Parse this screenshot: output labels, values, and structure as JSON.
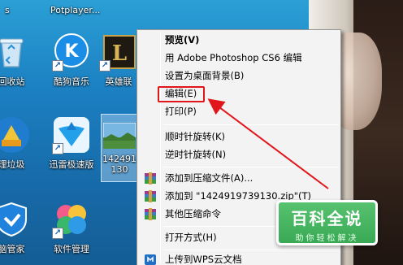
{
  "desktop": {
    "top_labels": [
      "s",
      "Potplayer..."
    ],
    "icons": [
      {
        "label": "回收站",
        "icon": "recycle-bin-icon"
      },
      {
        "label": "酷狗音乐",
        "icon": "kugou-music-icon"
      },
      {
        "label": "英雄联",
        "icon": "league-of-legends-icon"
      },
      {
        "label": "理垃圾",
        "icon": "cleanup-icon"
      },
      {
        "label": "迅雷极速版",
        "icon": "xunlei-icon"
      },
      {
        "label": "142491",
        "label2": "130",
        "icon": "image-file-icon"
      },
      {
        "label": "脑管家",
        "icon": "pc-manager-icon"
      },
      {
        "label": "软件管理",
        "icon": "software-manager-icon"
      }
    ]
  },
  "context_menu": {
    "items": [
      {
        "label": "预览(V)",
        "bold": true
      },
      {
        "label": "用 Adobe Photoshop CS6 编辑"
      },
      {
        "label": "设置为桌面背景(B)"
      },
      {
        "label": "编辑(E)",
        "highlighted": true
      },
      {
        "label": "打印(P)"
      },
      {
        "label": "顺时针旋转(K)"
      },
      {
        "label": "逆时针旋转(N)"
      },
      {
        "label": "添加到压缩文件(A)...",
        "icon": "winrar-icon"
      },
      {
        "label": "添加到 \"1424919739130.zip\"(T)",
        "icon": "winrar-icon"
      },
      {
        "label": "其他压缩命令",
        "icon": "winrar-icon",
        "submenu": true
      },
      {
        "label": "打开方式(H)",
        "submenu": true
      },
      {
        "label": "上传到WPS云文档",
        "icon": "wps-cloud-icon"
      }
    ]
  },
  "logo": {
    "title": "百科全说",
    "subtitle": "助你轻松解决"
  },
  "colors": {
    "highlight": "#e0161b",
    "logo_green": "#3aa957"
  }
}
